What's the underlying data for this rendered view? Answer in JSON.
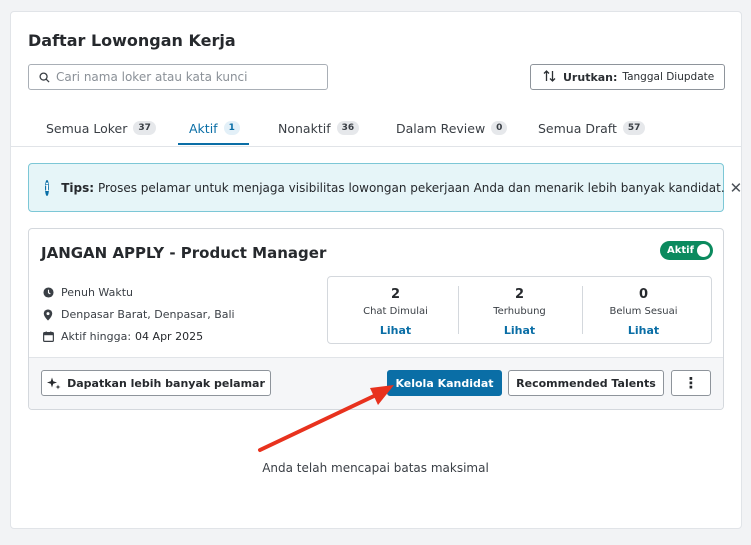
{
  "page": {
    "title": "Daftar Lowongan Kerja",
    "search_placeholder": "Cari nama loker atau kata kunci",
    "sort": {
      "label": "Urutkan:",
      "value": "Tanggal Diupdate"
    }
  },
  "tabs": [
    {
      "label": "Semua Loker",
      "count": "37",
      "active": false
    },
    {
      "label": "Aktif",
      "count": "1",
      "active": true
    },
    {
      "label": "Nonaktif",
      "count": "36",
      "active": false
    },
    {
      "label": "Dalam Review",
      "count": "0",
      "active": false
    },
    {
      "label": "Semua Draft",
      "count": "57",
      "active": false
    }
  ],
  "tips": {
    "label": "Tips:",
    "text": "Proses pelamar untuk menjaga visibilitas lowongan pekerjaan Anda dan menarik lebih banyak kandidat.",
    "close": "✕"
  },
  "job": {
    "title": "JANGAN APPLY - Product Manager",
    "status": "Aktif",
    "type": "Penuh Waktu",
    "location": "Denpasar Barat, Denpasar, Bali",
    "active_until_label": "Aktif hingga:",
    "active_until_date": "04 Apr 2025",
    "stats": [
      {
        "value": "2",
        "label": "Chat Dimulai",
        "link": "Lihat"
      },
      {
        "value": "2",
        "label": "Terhubung",
        "link": "Lihat"
      },
      {
        "value": "0",
        "label": "Belum Sesuai",
        "link": "Lihat"
      }
    ],
    "actions": {
      "more_applicants": "Dapatkan lebih banyak pelamar",
      "manage_candidates": "Kelola Kandidat",
      "recommended_talents": "Recommended Talents",
      "more": "⋮"
    }
  },
  "footer_text": "Anda telah mencapai batas maksimal",
  "colors": {
    "primary": "#0a6ea6",
    "active_toggle": "#0b8a5e",
    "annotation_arrow": "#e8321e"
  }
}
